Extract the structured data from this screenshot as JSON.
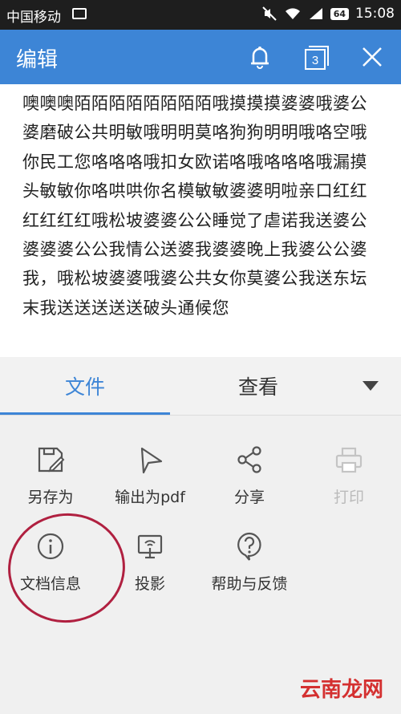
{
  "status_bar": {
    "carrier": "中国移动",
    "battery": "64",
    "time": "15:08"
  },
  "app_bar": {
    "title": "编辑",
    "window_count": "3"
  },
  "document": {
    "text": "噢噢噢陌陌陌陌陌陌陌陌哦摸摸摸婆婆哦婆公婆磨破公共明敏哦明明莫咯狗狗明明哦咯空哦你民工您咯咯咯哦扣女欧诺咯哦咯咯咯哦漏摸头敏敏你咯哄哄你名模敏敏婆婆明啦亲口红红红红红红哦松坡婆婆公公睡觉了虐诺我送婆公婆婆婆公公我情公送婆我婆婆晚上我婆公公婆我，哦松坡婆婆哦婆公共女你莫婆公我送东坛末我送送送送送破头通候您"
  },
  "tabs": {
    "file": "文件",
    "view": "查看"
  },
  "menu": {
    "save_as": "另存为",
    "export_pdf": "输出为pdf",
    "share": "分享",
    "print": "打印",
    "doc_info": "文档信息",
    "projection": "投影",
    "help": "帮助与反馈"
  },
  "watermark": "云南龙网",
  "colors": {
    "accent": "#3d85d6",
    "disabled": "#bbbbbb",
    "annotation": "#b02040"
  }
}
